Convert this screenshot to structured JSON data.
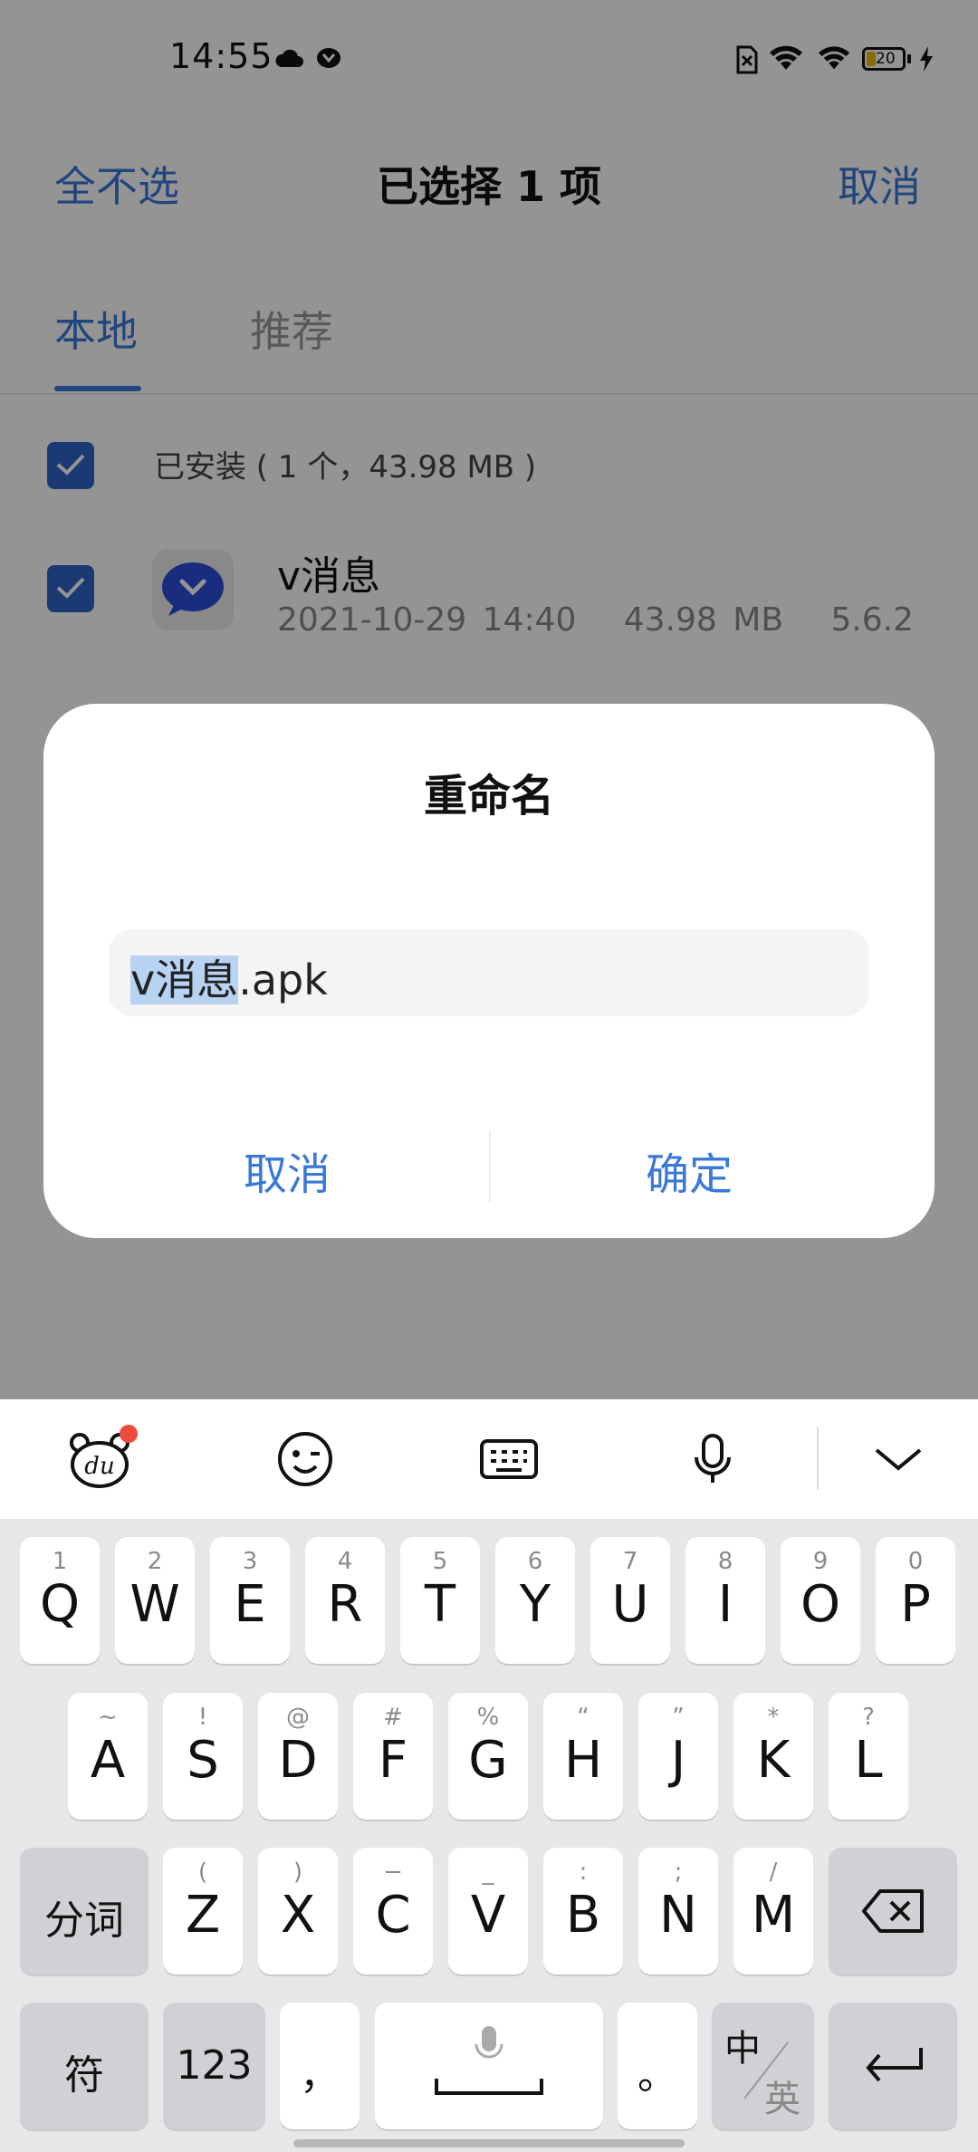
{
  "status_bar": {
    "time": "14:55",
    "battery_level": "20"
  },
  "top_bar": {
    "left_action": "全不选",
    "title": "已选择 1 项",
    "right_action": "取消"
  },
  "tabs": [
    {
      "label": "本地",
      "active": true
    },
    {
      "label": "推荐",
      "active": false
    }
  ],
  "list": {
    "group_label": "已安装 ( 1 个，43.98 MB )",
    "items": [
      {
        "name": "v消息",
        "date": "2021-10-29 14:40",
        "size": "43.98 MB",
        "version": "5.6.2",
        "checked": true
      }
    ]
  },
  "dialog": {
    "title": "重命名",
    "input_selected": "v消息",
    "input_suffix": ".apk",
    "cancel_label": "取消",
    "confirm_label": "确定"
  },
  "keyboard": {
    "row1": [
      {
        "main": "Q",
        "sub": "1"
      },
      {
        "main": "W",
        "sub": "2"
      },
      {
        "main": "E",
        "sub": "3"
      },
      {
        "main": "R",
        "sub": "4"
      },
      {
        "main": "T",
        "sub": "5"
      },
      {
        "main": "Y",
        "sub": "6"
      },
      {
        "main": "U",
        "sub": "7"
      },
      {
        "main": "I",
        "sub": "8"
      },
      {
        "main": "O",
        "sub": "9"
      },
      {
        "main": "P",
        "sub": "0"
      }
    ],
    "row2": [
      {
        "main": "A",
        "sub": "~"
      },
      {
        "main": "S",
        "sub": "!"
      },
      {
        "main": "D",
        "sub": "@"
      },
      {
        "main": "F",
        "sub": "#"
      },
      {
        "main": "G",
        "sub": "%"
      },
      {
        "main": "H",
        "sub": "“"
      },
      {
        "main": "J",
        "sub": "”"
      },
      {
        "main": "K",
        "sub": "*"
      },
      {
        "main": "L",
        "sub": "?"
      }
    ],
    "row3": [
      {
        "main": "Z",
        "sub": "("
      },
      {
        "main": "X",
        "sub": ")"
      },
      {
        "main": "C",
        "sub": "−"
      },
      {
        "main": "V",
        "sub": "_"
      },
      {
        "main": "B",
        "sub": ":"
      },
      {
        "main": "N",
        "sub": ";"
      },
      {
        "main": "M",
        "sub": "/"
      }
    ],
    "segment_key": "分词",
    "symbol_key": "符",
    "numbers_key": "123",
    "comma_key": "，",
    "period_key": "。",
    "lang_primary": "中",
    "lang_secondary": "英"
  },
  "colors": {
    "accent": "#3a78d8",
    "checkbox": "#2f64c8",
    "badge": "#ee4b3f"
  }
}
